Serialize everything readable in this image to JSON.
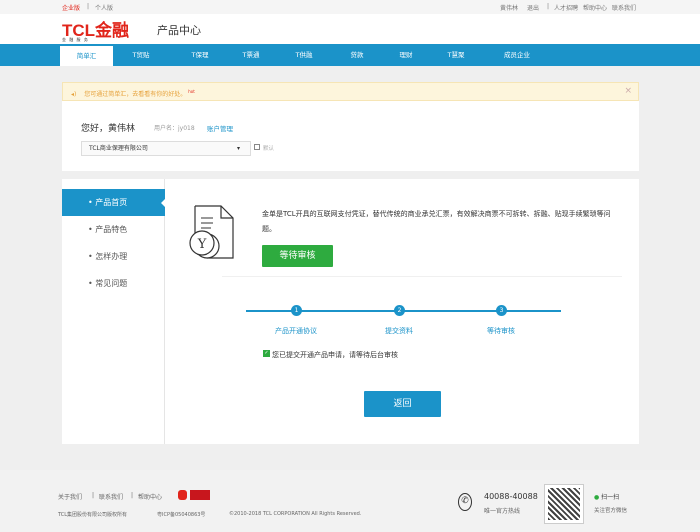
{
  "topbar": {
    "left": [
      "企业版",
      "个人版"
    ],
    "right": [
      "黄伟林",
      "退出",
      "人才招聘",
      "帮助中心",
      "联系我们"
    ]
  },
  "header": {
    "logo": "TCL金融",
    "logo_sub": "金  融  服  务",
    "title": "产品中心"
  },
  "nav": {
    "items": [
      "简单汇",
      "T贸贴",
      "T保理",
      "T票通",
      "T供融",
      "贷款",
      "理财",
      "T慧聚",
      "成员企业"
    ]
  },
  "notice": {
    "text": "您可通过简单汇，去看看有你的好处。",
    "badge": "hot",
    "close": "×"
  },
  "user": {
    "greeting": "您好，黄伟林",
    "username_label": "用户名：jy018",
    "account_link": "账户管理",
    "company": "TCL商业保理有限公司",
    "default_label": "默认"
  },
  "sidebar": {
    "items": [
      "产品首页",
      "产品特色",
      "怎样办理",
      "常见问题"
    ]
  },
  "product": {
    "description": "金单是TCL开具的互联网支付凭证，替代传统的商业承兑汇票，有效解决商票不可拆转、拆融、贴现手续繁琐等问题。",
    "status_button": "等待审核"
  },
  "steps": [
    {
      "num": "1",
      "label": "产品开通协议"
    },
    {
      "num": "2",
      "label": "提交资料"
    },
    {
      "num": "3",
      "label": "等待审核"
    }
  ],
  "submitted_msg": "您已提交开通产品申请，请等待后台审核",
  "back_button": "返回",
  "footer": {
    "links": [
      "关于我们",
      "联系我们",
      "帮助中心"
    ],
    "copyright_company": "TCL集团股份有限公司版权所有",
    "icp": "粤ICP备05040863号",
    "copyright": "©2010-2018 TCL CORPORATION All Rights Reserved.",
    "phone": "40088-40088",
    "phone_label": "唯一官方热线",
    "wechat": "扫一扫",
    "wechat_sub": "关注官方微信"
  },
  "colors": {
    "brand": "#1b93c9",
    "red": "#e1251b",
    "green": "#2eab3f"
  }
}
